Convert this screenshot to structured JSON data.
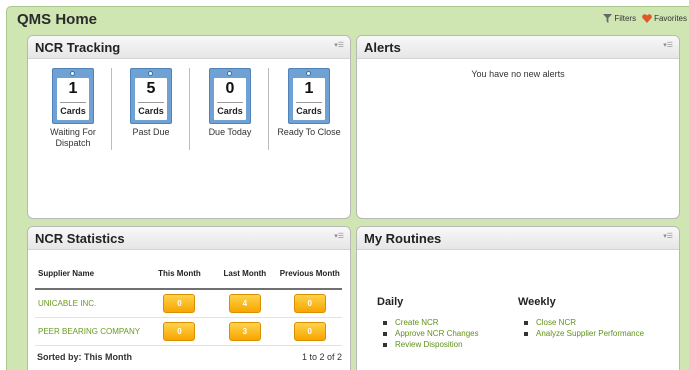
{
  "home": {
    "title": "QMS Home",
    "filters_label": "Filters",
    "favorites_label": "Favorites"
  },
  "tracking": {
    "title": "NCR Tracking",
    "trackers": [
      {
        "count": "1",
        "unit": "Cards",
        "label": "Waiting For Dispatch"
      },
      {
        "count": "5",
        "unit": "Cards",
        "label": "Past Due"
      },
      {
        "count": "0",
        "unit": "Cards",
        "label": "Due Today"
      },
      {
        "count": "1",
        "unit": "Cards",
        "label": "Ready To Close"
      }
    ]
  },
  "alerts": {
    "title": "Alerts",
    "message": "You have no new alerts"
  },
  "stats": {
    "title": "NCR Statistics",
    "columns": [
      "Supplier Name",
      "This Month",
      "Last Month",
      "Previous Month"
    ],
    "rows": [
      {
        "supplier": "UNICABLE INC.",
        "this_month": "0",
        "last_month": "4",
        "previous_month": "0"
      },
      {
        "supplier": "PEER BEARING COMPANY",
        "this_month": "0",
        "last_month": "3",
        "previous_month": "0"
      }
    ],
    "sorted_by": "Sorted by: This Month",
    "pagination": "1 to 2 of 2"
  },
  "routines": {
    "title": "My Routines",
    "daily": {
      "title": "Daily",
      "items": [
        "Create NCR",
        "Approve NCR Changes",
        "Review Disposition"
      ]
    },
    "weekly": {
      "title": "Weekly",
      "items": [
        "Close NCR",
        "Analyze Supplier Performance"
      ]
    }
  },
  "colors": {
    "background": "#cfe6b2",
    "badge": "#f7a500",
    "card": "#6fa1d2",
    "link": "#6a9a1f"
  }
}
